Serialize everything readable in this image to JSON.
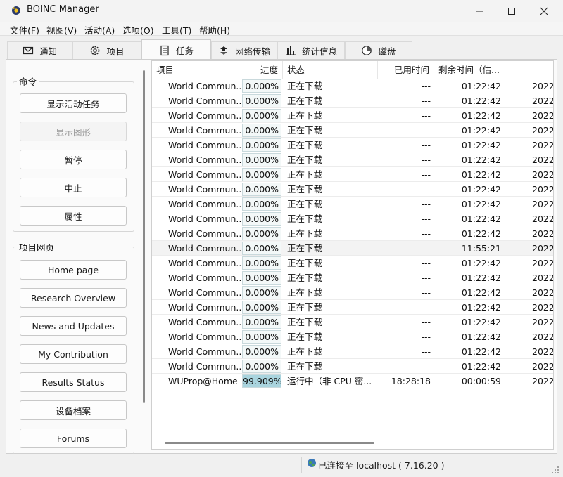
{
  "window": {
    "title": "BOINC Manager",
    "controls": [
      "minimize",
      "maximize",
      "close"
    ]
  },
  "menu": [
    "文件(F)",
    "视图(V)",
    "活动(A)",
    "选项(O)",
    "工具(T)",
    "帮助(H)"
  ],
  "tabs": [
    {
      "label": "通知",
      "icon": "envelope-icon",
      "active": false
    },
    {
      "label": "项目",
      "icon": "gear-icon",
      "active": false
    },
    {
      "label": "任务",
      "icon": "document-icon",
      "active": true
    },
    {
      "label": "网络传输",
      "icon": "transfer-icon",
      "active": false
    },
    {
      "label": "统计信息",
      "icon": "bar-chart-icon",
      "active": false
    },
    {
      "label": "磁盘",
      "icon": "disk-icon",
      "active": false
    }
  ],
  "commands": {
    "title": "命令",
    "buttons": [
      {
        "label": "显示活动任务",
        "enabled": true
      },
      {
        "label": "显示图形",
        "enabled": false
      },
      {
        "label": "暂停",
        "enabled": true
      },
      {
        "label": "中止",
        "enabled": true
      },
      {
        "label": "属性",
        "enabled": true
      }
    ]
  },
  "project_web": {
    "title": "项目网页",
    "buttons": [
      "Home page",
      "Research Overview",
      "News and Updates",
      "My Contribution",
      "Results Status",
      "设备档案",
      "Forums"
    ]
  },
  "columns": [
    "项目",
    "进度",
    "状态",
    "已用时间",
    "剩余时间（估..."
  ],
  "rows": [
    {
      "project": "World Commun...",
      "progress": "0.000%",
      "progress_value": 0,
      "status": "正在下载",
      "elapsed": "---",
      "remaining": "01:22:42",
      "deadline": "2022"
    },
    {
      "project": "World Commun...",
      "progress": "0.000%",
      "progress_value": 0,
      "status": "正在下载",
      "elapsed": "---",
      "remaining": "01:22:42",
      "deadline": "2022"
    },
    {
      "project": "World Commun...",
      "progress": "0.000%",
      "progress_value": 0,
      "status": "正在下载",
      "elapsed": "---",
      "remaining": "01:22:42",
      "deadline": "2022"
    },
    {
      "project": "World Commun...",
      "progress": "0.000%",
      "progress_value": 0,
      "status": "正在下载",
      "elapsed": "---",
      "remaining": "01:22:42",
      "deadline": "2022"
    },
    {
      "project": "World Commun...",
      "progress": "0.000%",
      "progress_value": 0,
      "status": "正在下载",
      "elapsed": "---",
      "remaining": "01:22:42",
      "deadline": "2022"
    },
    {
      "project": "World Commun...",
      "progress": "0.000%",
      "progress_value": 0,
      "status": "正在下载",
      "elapsed": "---",
      "remaining": "01:22:42",
      "deadline": "2022"
    },
    {
      "project": "World Commun...",
      "progress": "0.000%",
      "progress_value": 0,
      "status": "正在下载",
      "elapsed": "---",
      "remaining": "01:22:42",
      "deadline": "2022"
    },
    {
      "project": "World Commun...",
      "progress": "0.000%",
      "progress_value": 0,
      "status": "正在下载",
      "elapsed": "---",
      "remaining": "01:22:42",
      "deadline": "2022"
    },
    {
      "project": "World Commun...",
      "progress": "0.000%",
      "progress_value": 0,
      "status": "正在下载",
      "elapsed": "---",
      "remaining": "01:22:42",
      "deadline": "2022"
    },
    {
      "project": "World Commun...",
      "progress": "0.000%",
      "progress_value": 0,
      "status": "正在下载",
      "elapsed": "---",
      "remaining": "01:22:42",
      "deadline": "2022"
    },
    {
      "project": "World Commun...",
      "progress": "0.000%",
      "progress_value": 0,
      "status": "正在下载",
      "elapsed": "---",
      "remaining": "01:22:42",
      "deadline": "2022"
    },
    {
      "project": "World Commun...",
      "progress": "0.000%",
      "progress_value": 0,
      "status": "正在下载",
      "elapsed": "---",
      "remaining": "11:55:21",
      "deadline": "2022"
    },
    {
      "project": "World Commun...",
      "progress": "0.000%",
      "progress_value": 0,
      "status": "正在下载",
      "elapsed": "---",
      "remaining": "01:22:42",
      "deadline": "2022"
    },
    {
      "project": "World Commun...",
      "progress": "0.000%",
      "progress_value": 0,
      "status": "正在下载",
      "elapsed": "---",
      "remaining": "01:22:42",
      "deadline": "2022"
    },
    {
      "project": "World Commun...",
      "progress": "0.000%",
      "progress_value": 0,
      "status": "正在下载",
      "elapsed": "---",
      "remaining": "01:22:42",
      "deadline": "2022"
    },
    {
      "project": "World Commun...",
      "progress": "0.000%",
      "progress_value": 0,
      "status": "正在下载",
      "elapsed": "---",
      "remaining": "01:22:42",
      "deadline": "2022"
    },
    {
      "project": "World Commun...",
      "progress": "0.000%",
      "progress_value": 0,
      "status": "正在下载",
      "elapsed": "---",
      "remaining": "01:22:42",
      "deadline": "2022"
    },
    {
      "project": "World Commun...",
      "progress": "0.000%",
      "progress_value": 0,
      "status": "正在下载",
      "elapsed": "---",
      "remaining": "01:22:42",
      "deadline": "2022"
    },
    {
      "project": "World Commun...",
      "progress": "0.000%",
      "progress_value": 0,
      "status": "正在下载",
      "elapsed": "---",
      "remaining": "01:22:42",
      "deadline": "2022"
    },
    {
      "project": "World Commun...",
      "progress": "0.000%",
      "progress_value": 0,
      "status": "正在下载",
      "elapsed": "---",
      "remaining": "01:22:42",
      "deadline": "2022"
    },
    {
      "project": "WUProp@Home",
      "progress": "99.909%",
      "progress_value": 99.909,
      "status": "运行中（非 CPU 密...",
      "elapsed": "18:28:18",
      "remaining": "00:00:59",
      "deadline": "2022"
    }
  ],
  "status_bar": {
    "text": "已连接至 localhost ( 7.16.20 )",
    "icon": "connected-globe-icon"
  },
  "colors": {
    "progress_fill": "#a9d4de",
    "row_alt": "#f3f3f3",
    "selected_tab": "#fafafa"
  }
}
